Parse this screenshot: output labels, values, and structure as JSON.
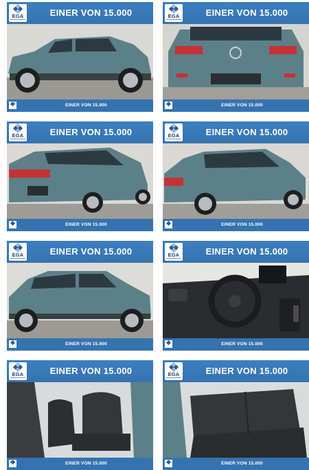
{
  "logo_text": "EGA",
  "cards": [
    {
      "headline": "EINER VON 15.000",
      "footer": "EINER VON 15.000"
    },
    {
      "headline": "EINER VON 15.000",
      "footer": "EINER VON 15.000"
    },
    {
      "headline": "EINER VON 15.000",
      "footer": "EINER VON 15.000"
    },
    {
      "headline": "EINER VON 15.000",
      "footer": "EINER VON 15.000"
    },
    {
      "headline": "EINER VON 15.000",
      "footer": "EINER VON 15.000"
    },
    {
      "headline": "EINER VON 15.000",
      "footer": "EINER VON 15.000"
    },
    {
      "headline": "EINER VON 15.000",
      "footer": "EINER VON 15.000"
    },
    {
      "headline": "EINER VON 15.000",
      "footer": "EINER VON 15.000"
    }
  ],
  "colors": {
    "banner_blue": "#3573b0",
    "car_body": "#5c8088",
    "interior_dark": "#2a2c30"
  }
}
